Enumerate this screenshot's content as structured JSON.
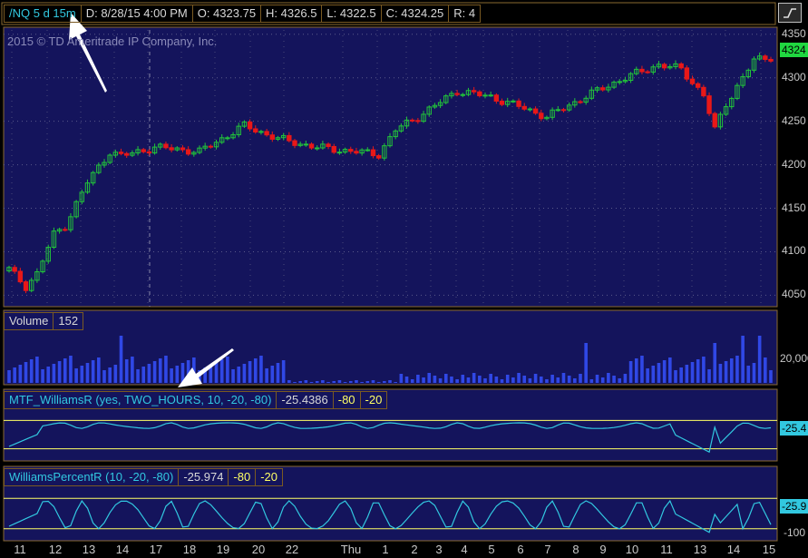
{
  "header": {
    "symbol": "/NQ 5 d 15m",
    "date": "D: 8/28/15 4:00 PM",
    "open": "O: 4323.75",
    "high": "H: 4326.5",
    "low": "L: 4322.5",
    "close": "C: 4324.25",
    "range": "R: 4"
  },
  "copyright": "2015 © TD Ameritrade IP Company, Inc.",
  "price_axis": {
    "ticks": [
      "4350",
      "4300",
      "4250",
      "4200",
      "4150",
      "4100",
      "4050"
    ],
    "last": "4324"
  },
  "volume_panel": {
    "label": "Volume",
    "value": "152",
    "ticks": [
      "20,000"
    ]
  },
  "mtf_panel": {
    "label": "MTF_WilliamsR (yes, TWO_HOURS, 10, -20, -80)",
    "value": "-25.4386",
    "low_level": "-80",
    "high_level": "-20",
    "badge": "-25.4"
  },
  "wr_panel": {
    "label": "WilliamsPercentR (10, -20, -80)",
    "value": "-25.974",
    "low_level": "-80",
    "high_level": "-20",
    "badge": "-25.9",
    "axis_tick": "-100"
  },
  "x_axis": {
    "labels": [
      "11",
      "12",
      "13",
      "14",
      "17",
      "18",
      "19",
      "20",
      "22",
      "Thu",
      "1",
      "2",
      "3",
      "4",
      "5",
      "6",
      "7",
      "8",
      "9",
      "10",
      "11",
      "13",
      "14",
      "15"
    ]
  },
  "colors": {
    "background": "#14145c",
    "frame": "#8a6a30",
    "up": "#22c43a",
    "down": "#e81818",
    "volume": "#3048e6",
    "indicator": "#32c8e0",
    "level": "#ffff66"
  },
  "chart_data": {
    "type": "candlestick",
    "y_range": [
      4040,
      4355
    ],
    "anchors": [
      [
        0,
        4080
      ],
      [
        3,
        4060
      ],
      [
        5,
        4075
      ],
      [
        8,
        4120
      ],
      [
        10,
        4130
      ],
      [
        14,
        4180
      ],
      [
        18,
        4215
      ],
      [
        20,
        4210
      ],
      [
        26,
        4220
      ],
      [
        30,
        4218
      ],
      [
        34,
        4215
      ],
      [
        38,
        4230
      ],
      [
        42,
        4245
      ],
      [
        48,
        4230
      ],
      [
        55,
        4220
      ],
      [
        62,
        4215
      ],
      [
        66,
        4212
      ],
      [
        69,
        4240
      ],
      [
        73,
        4255
      ],
      [
        80,
        4285
      ],
      [
        86,
        4278
      ],
      [
        92,
        4265
      ],
      [
        96,
        4255
      ],
      [
        104,
        4282
      ],
      [
        110,
        4300
      ],
      [
        116,
        4315
      ],
      [
        120,
        4310
      ],
      [
        124,
        4280
      ],
      [
        126,
        4240
      ],
      [
        128,
        4270
      ],
      [
        131,
        4300
      ],
      [
        133,
        4320
      ],
      [
        136,
        4324
      ]
    ],
    "volume_level": "20,000"
  }
}
